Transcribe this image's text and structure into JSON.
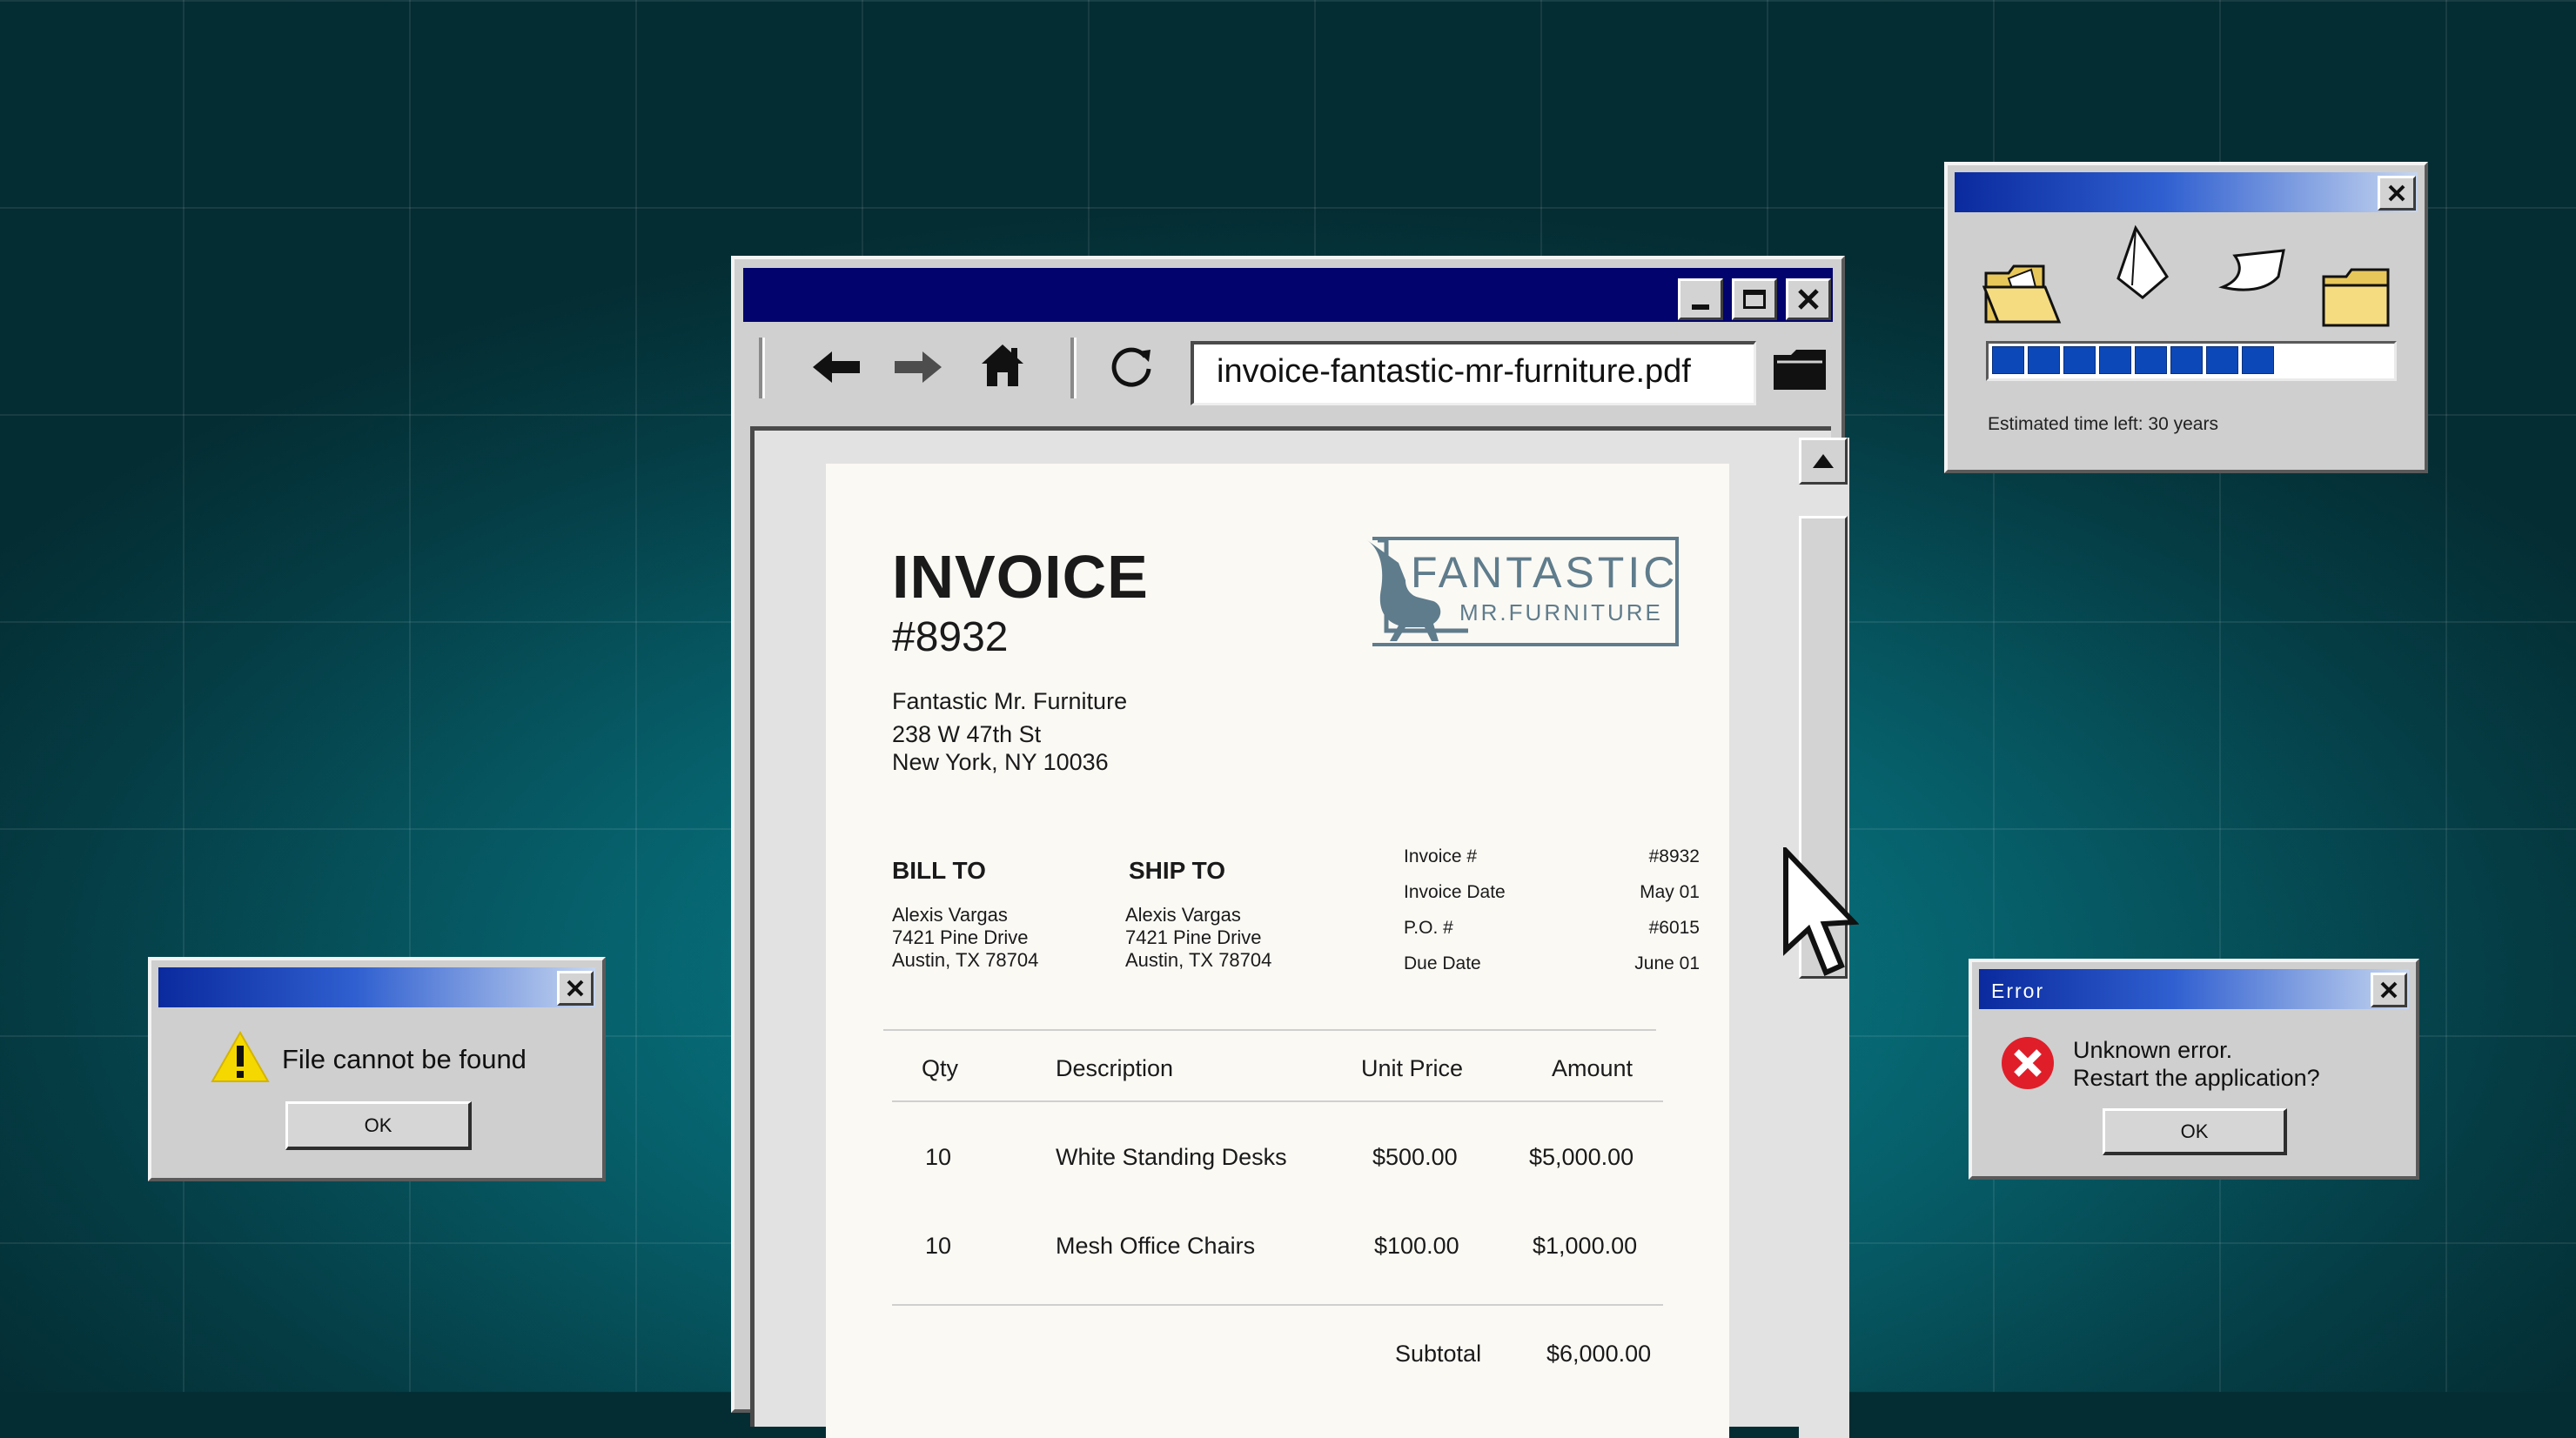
{
  "browser": {
    "url": "invoice-fantastic-mr-furniture.pdf"
  },
  "invoice": {
    "heading": "INVOICE",
    "number": "#8932",
    "company_name": "Fantastic Mr. Furniture",
    "company_address_1": "238 W 47th St",
    "company_address_2": "New York, NY 10036",
    "logo_text_1": "FANTASTIC",
    "logo_text_2": "MR.FURNITURE",
    "bill_to": {
      "label": "BILL TO",
      "name": "Alexis Vargas",
      "line1": "7421 Pine Drive",
      "line2": "Austin, TX 78704"
    },
    "ship_to": {
      "label": "SHIP TO",
      "name": "Alexis Vargas",
      "line1": "7421 Pine Drive",
      "line2": "Austin, TX 78704"
    },
    "meta": [
      {
        "label": "Invoice #",
        "value": "#8932"
      },
      {
        "label": "Invoice Date",
        "value": "May 01"
      },
      {
        "label": "P.O. #",
        "value": "#6015"
      },
      {
        "label": "Due Date",
        "value": "June 01"
      }
    ],
    "columns": [
      "Qty",
      "Description",
      "Unit Price",
      "Amount"
    ],
    "rows": [
      {
        "qty": "10",
        "description": "White Standing Desks",
        "unit_price": "$500.00",
        "amount": "$5,000.00"
      },
      {
        "qty": "10",
        "description": "Mesh Office Chairs",
        "unit_price": "$100.00",
        "amount": "$1,000.00"
      }
    ],
    "subtotal_label": "Subtotal",
    "subtotal_value": "$6,000.00"
  },
  "copy_dialog": {
    "progress_segments": 8,
    "status": "Estimated time left: 30 years"
  },
  "warning_dialog": {
    "message": "File cannot be found",
    "ok_label": "OK"
  },
  "error_dialog": {
    "title": "Error",
    "line1": "Unknown error.",
    "line2": "Restart the application?",
    "ok_label": "OK"
  },
  "colors": {
    "title_bar": "#03036e",
    "progress": "#0d48b8",
    "error_red": "#e01e2a",
    "warning_yellow": "#f5d800",
    "logo": "#5f7c8c"
  }
}
